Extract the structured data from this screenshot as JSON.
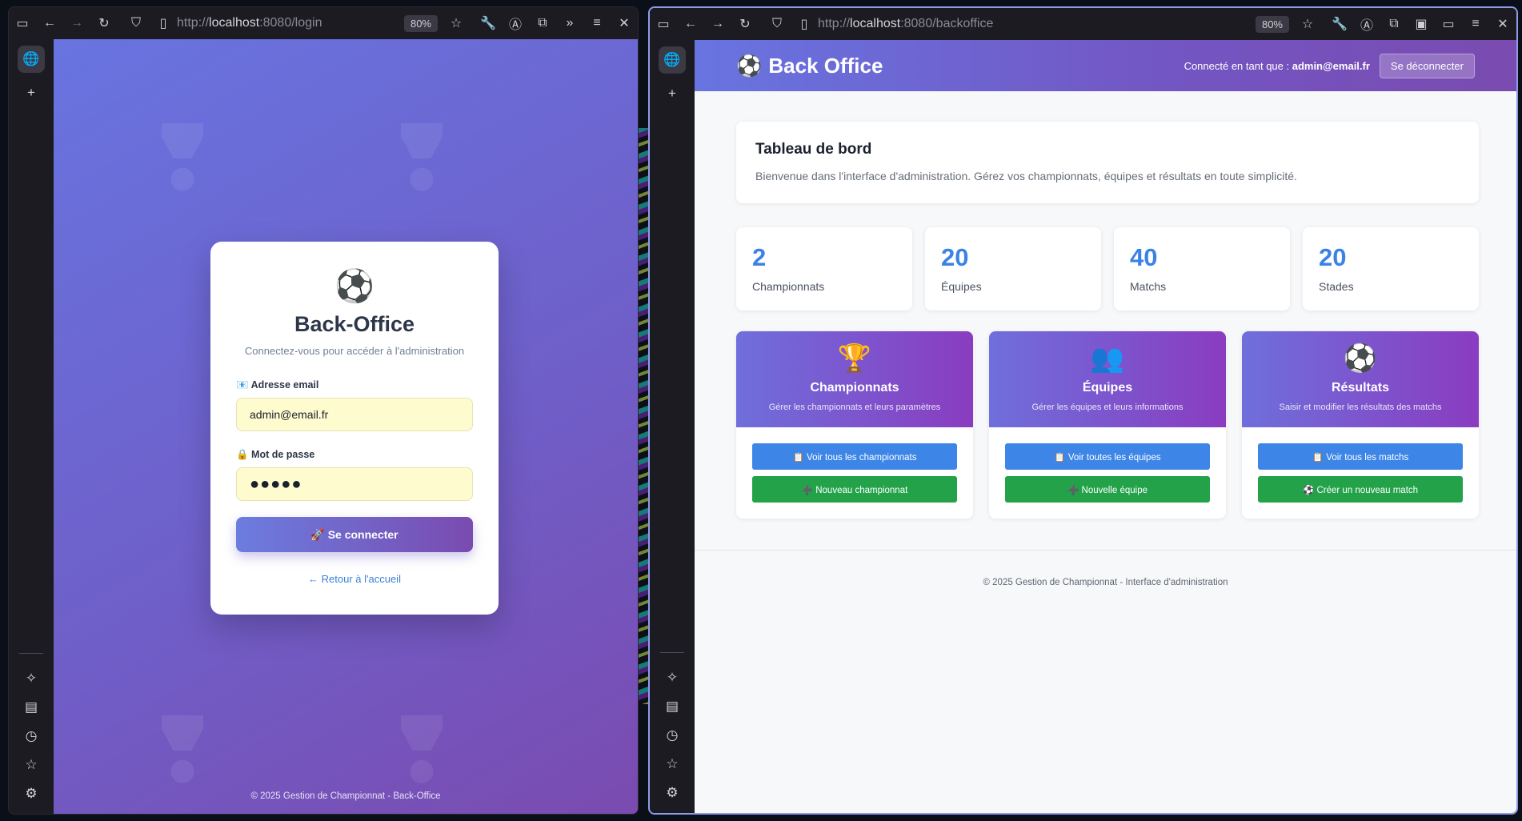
{
  "left_window": {
    "url_prefix": "http://",
    "url_host": "localhost",
    "url_suffix": ":8080/login",
    "zoom": "80%"
  },
  "right_window": {
    "url_prefix": "http://",
    "url_host": "localhost",
    "url_suffix": ":8080/backoffice",
    "zoom": "80%"
  },
  "login": {
    "logo": "⚽",
    "title": "Back-Office",
    "subtitle": "Connectez-vous pour accéder à l'administration",
    "email_label": "📧 Adresse email",
    "email_value": "admin@email.fr",
    "password_label": "🔒 Mot de passe",
    "password_value": "●●●●●",
    "submit_label": "🚀 Se connecter",
    "back_link": "←  Retour à l'accueil",
    "footer": "© 2025 Gestion de Championnat - Back-Office"
  },
  "backoffice": {
    "brand_icon": "⚽",
    "brand": "Back Office",
    "user_prefix": "Connecté en tant que : ",
    "user_email": "admin@email.fr",
    "logout_label": "Se déconnecter",
    "dashboard_title": "Tableau de bord",
    "dashboard_text": "Bienvenue dans l'interface d'administration. Gérez vos championnats, équipes et résultats en toute simplicité.",
    "stats": [
      {
        "value": "2",
        "label": "Championnats"
      },
      {
        "value": "20",
        "label": "Équipes"
      },
      {
        "value": "40",
        "label": "Matchs"
      },
      {
        "value": "20",
        "label": "Stades"
      }
    ],
    "modules": [
      {
        "icon": "🏆",
        "title": "Championnats",
        "desc": "Gérer les championnats et leurs paramètres",
        "primary": "📋 Voir tous les championnats",
        "secondary": "➕ Nouveau championnat"
      },
      {
        "icon": "👥",
        "title": "Équipes",
        "desc": "Gérer les équipes et leurs informations",
        "primary": "📋 Voir toutes les équipes",
        "secondary": "➕ Nouvelle équipe"
      },
      {
        "icon": "⚽",
        "title": "Résultats",
        "desc": "Saisir et modifier les résultats des matchs",
        "primary": "📋 Voir tous les matchs",
        "secondary": "⚽ Créer un nouveau match"
      }
    ],
    "footer": "© 2025 Gestion de Championnat - Interface d'administration"
  },
  "colors": {
    "gradient_start": "#6874e0",
    "gradient_end": "#7a4bb0",
    "stat_blue": "#3b82e6",
    "btn_blue": "#3d86e8",
    "btn_green": "#23a24a"
  }
}
